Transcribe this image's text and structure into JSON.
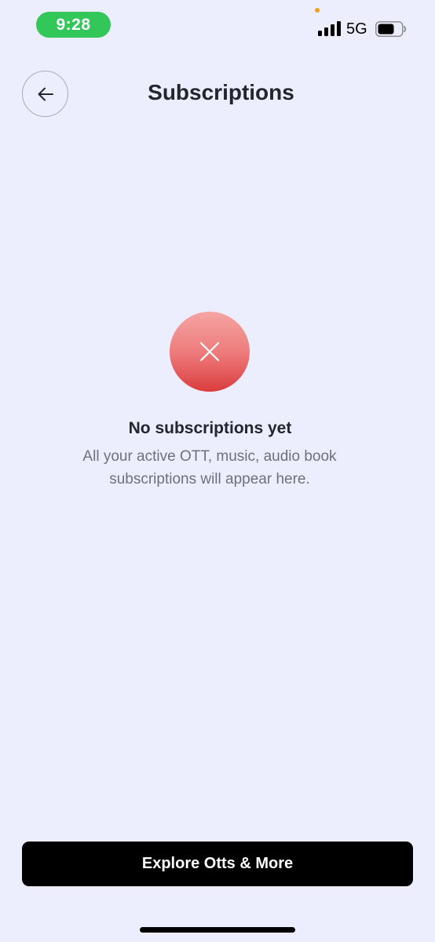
{
  "status_bar": {
    "time": "9:28",
    "network": "5G",
    "time_pill_color": "#33c659",
    "privacy_dot_color": "#f5a11f",
    "signal_icon": "cellular-signal-icon",
    "battery_icon": "battery-icon"
  },
  "header": {
    "title": "Subscriptions",
    "back_icon": "arrow-left-icon"
  },
  "empty_state": {
    "icon": "close-x-icon",
    "icon_gradient": [
      "#f6a4a4",
      "#da3c3e"
    ],
    "title": "No subscriptions yet",
    "description": "All your active OTT, music, audio book subscriptions will appear here."
  },
  "cta": {
    "label": "Explore Otts & More",
    "background": "#000000"
  },
  "theme": {
    "background": "#eceefd",
    "text_primary": "#23252f",
    "text_secondary": "#6e707b"
  }
}
